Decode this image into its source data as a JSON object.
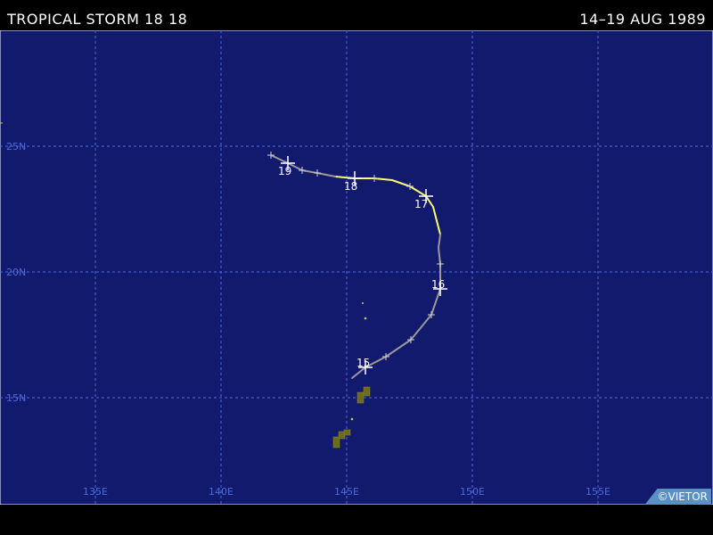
{
  "header": {
    "title": "TROPICAL STORM 18 18",
    "dates": "14–19 AUG 1989"
  },
  "map": {
    "background_color": "#121a6e",
    "grid_color": "#4f6ad8",
    "lat_labels": [
      "25N",
      "20N",
      "15N"
    ],
    "lon_labels": [
      "135E",
      "140E",
      "145E",
      "150E",
      "155E"
    ],
    "day_labels": [
      "19",
      "18",
      "17",
      "16",
      "15"
    ],
    "track_colors": {
      "depression": "#9a9a9a",
      "storm": "#ffff66",
      "land": "#6b6b1e"
    }
  },
  "credit": "©VIETOR"
}
